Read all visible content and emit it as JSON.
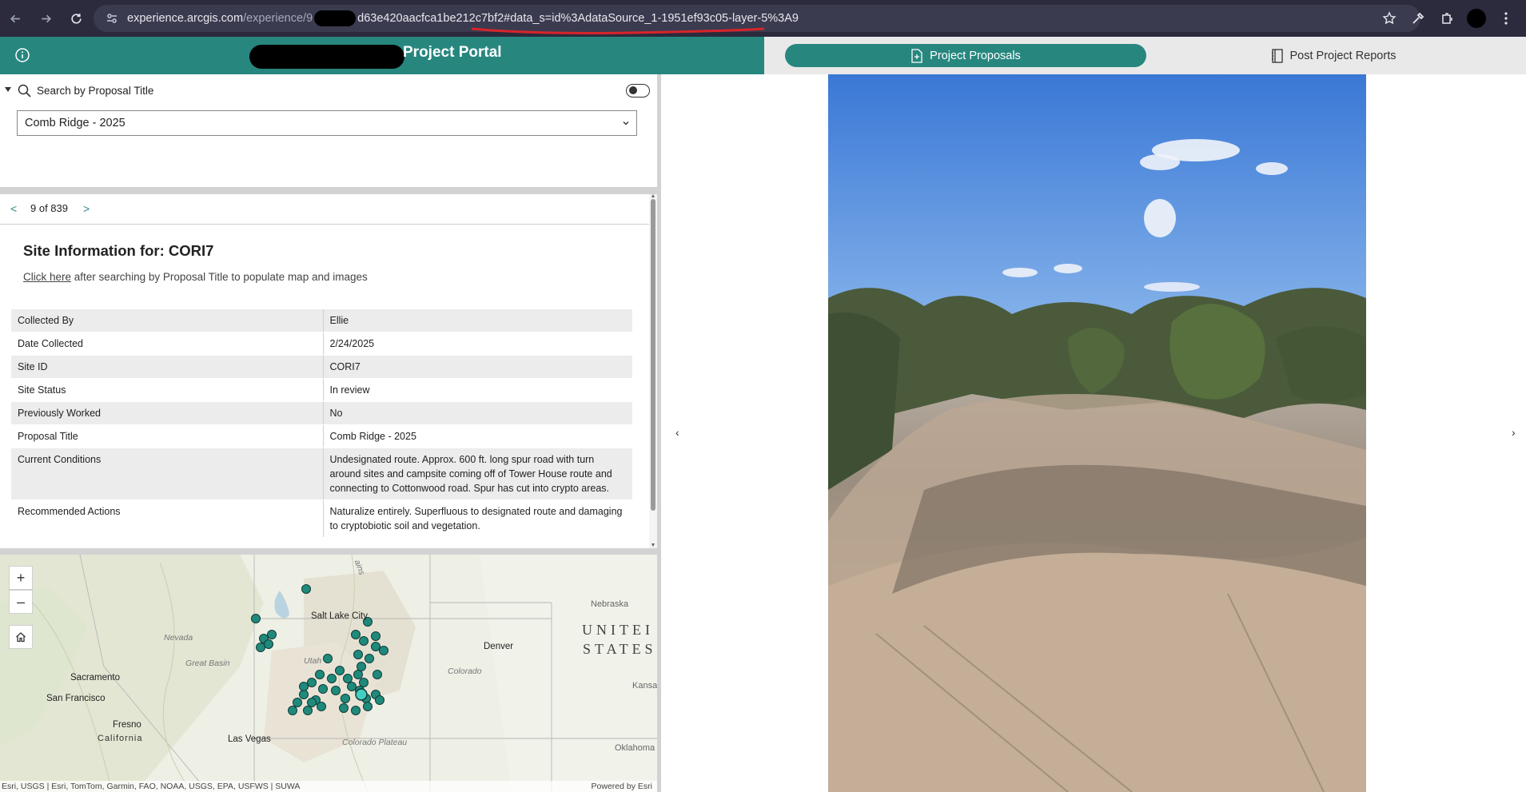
{
  "browser": {
    "url_host": "experience.arcgis.com",
    "url_path": "/experience/9",
    "url_rest": "d63e420aacfca1be212c7bf2#data_s=id%3AdataSource_1-1951ef93c05-layer-5%3A9"
  },
  "header": {
    "title": "Project Portal"
  },
  "tabs": [
    {
      "label": "Project Proposals",
      "active": true
    },
    {
      "label": "Post Project Reports",
      "active": false
    }
  ],
  "search": {
    "label": "Search by Proposal Title",
    "selected": "Comb Ridge - 2025"
  },
  "pager": {
    "prev": "<",
    "count": "9 of 839",
    "next": ">"
  },
  "site": {
    "title": "Site Information for: CORI7",
    "click_link": "Click here",
    "click_rest": " after searching by Proposal Title to populate map and images",
    "rows": [
      {
        "key": "Collected By",
        "value": "Ellie"
      },
      {
        "key": "Date Collected",
        "value": "2/24/2025"
      },
      {
        "key": "Site ID",
        "value": "CORI7"
      },
      {
        "key": "Site Status",
        "value": "In review"
      },
      {
        "key": "Previously Worked",
        "value": "No"
      },
      {
        "key": "Proposal Title",
        "value": "Comb Ridge - 2025"
      },
      {
        "key": "Current Conditions",
        "value": "Undesignated route. Approx. 600 ft. long spur road with turn around sites and campsite coming off of Tower House route and connecting to Cottonwood road. Spur has cut into crypto areas."
      },
      {
        "key": "Recommended Actions",
        "value": "Naturalize entirely. Superfluous to designated route and damaging to cryptobiotic soil and vegetation."
      }
    ]
  },
  "map": {
    "zoom_in": "+",
    "zoom_out": "–",
    "labels": {
      "salt_lake": "Salt Lake City",
      "nevada": "Nevada",
      "great_basin": "Great Basin",
      "utah": "Utah",
      "sacramento": "Sacramento",
      "san_francisco": "San Francisco",
      "fresno": "Fresno",
      "california": "California",
      "las_vegas": "Las Vegas",
      "denver": "Denver",
      "colorado": "Colorado",
      "colorado_plateau": "Colorado\nPlateau",
      "nebraska": "Nebraska",
      "kansas": "Kansa",
      "oklahoma": "Oklahoma",
      "united": "UNITEI",
      "states": "STATES",
      "mountains": "ains"
    },
    "attribution": "Esri, USGS | Esri, TomTom, Garmin, FAO, NOAA, USGS, EPA, USFWS | SUWA",
    "powered": "Powered by Esri"
  },
  "colors": {
    "teal": "#27877f",
    "point": "#1f8a7c",
    "chrome": "#2b2b3d"
  },
  "icons": {
    "info": "info-icon",
    "search": "search-icon",
    "home": "home-icon",
    "prev_image": "chevron-left-icon",
    "next_image": "chevron-right-icon"
  }
}
